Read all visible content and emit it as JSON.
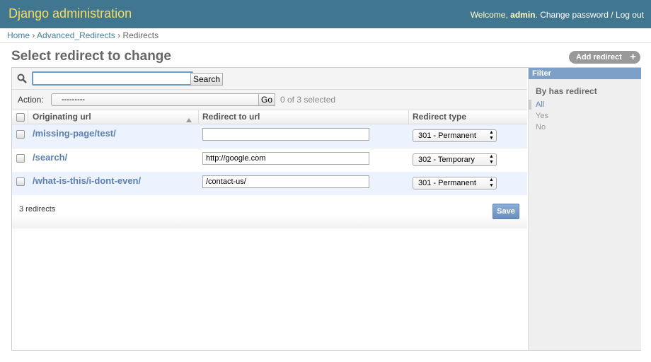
{
  "header": {
    "brand": "Django administration",
    "welcome": "Welcome,",
    "username": "admin",
    "change_password": "Change password",
    "separator": "/",
    "logout": "Log out"
  },
  "breadcrumbs": {
    "home": "Home",
    "app": "Advanced_Redirects",
    "current": "Redirects",
    "sep": "›"
  },
  "page": {
    "title": "Select redirect to change",
    "add_button": "Add redirect",
    "add_icon": "+"
  },
  "search": {
    "value": "",
    "button": "Search"
  },
  "actions": {
    "label": "Action:",
    "selected_option": "---------",
    "go_button": "Go",
    "selection_count": "0 of 3 selected"
  },
  "table": {
    "columns": [
      "Originating url",
      "Redirect to url",
      "Redirect type"
    ],
    "rows": [
      {
        "origin": "/missing-page/test/",
        "redirect": "",
        "type": "301 - Permanent"
      },
      {
        "origin": "/search/",
        "redirect": "http://google.com",
        "type": "302 - Temporary"
      },
      {
        "origin": "/what-is-this/i-dont-even/",
        "redirect": "/contact-us/",
        "type": "301 - Permanent"
      }
    ]
  },
  "paginator": {
    "count_text": "3 redirects",
    "save_button": "Save"
  },
  "filter": {
    "header": "Filter",
    "title": "By has redirect",
    "options": [
      "All",
      "Yes",
      "No"
    ],
    "selected": "All"
  },
  "colors": {
    "header_bg": "#417690",
    "brand": "#f5dd5d",
    "link": "#5b80b2",
    "row_alt": "#edf3fe",
    "filter_head": "#7ca0c7"
  }
}
